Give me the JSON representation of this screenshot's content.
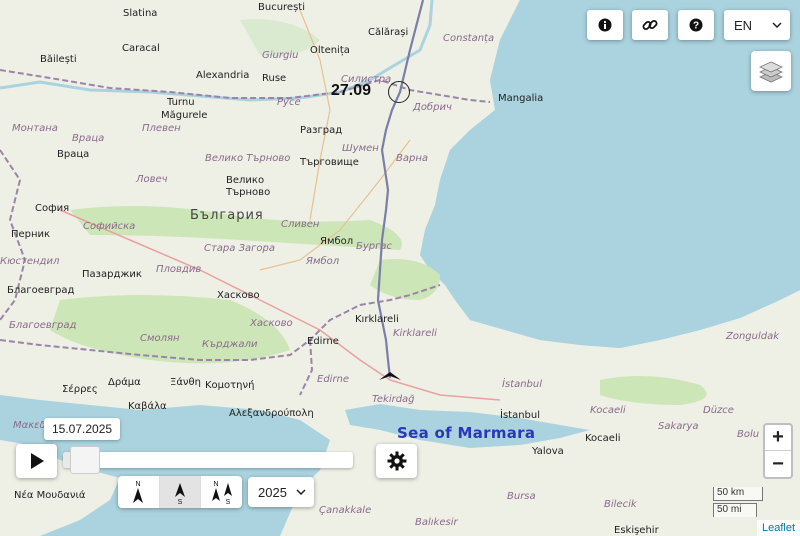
{
  "map": {
    "labels": [
      {
        "name": "place-bucuresti",
        "text": "București",
        "cls": "city"
      },
      {
        "name": "place-slatina",
        "text": "Slatina",
        "cls": "city"
      },
      {
        "name": "place-calarasi",
        "text": "Călărași",
        "cls": "city"
      },
      {
        "name": "place-constanta",
        "text": "Constanța",
        "cls": "region"
      },
      {
        "name": "place-caracal",
        "text": "Caracal",
        "cls": "city"
      },
      {
        "name": "place-giurgiu",
        "text": "Giurgiu",
        "cls": "region"
      },
      {
        "name": "place-oltenita",
        "text": "Oltenița",
        "cls": "city"
      },
      {
        "name": "place-bailesti",
        "text": "Băilești",
        "cls": "city"
      },
      {
        "name": "place-alexandria",
        "text": "Alexandria",
        "cls": "city"
      },
      {
        "name": "place-ruse-ro",
        "text": "Ruse",
        "cls": "city"
      },
      {
        "name": "place-silistra",
        "text": "Силистра",
        "cls": "region"
      },
      {
        "name": "place-mangalia",
        "text": "Mangalia",
        "cls": "city"
      },
      {
        "name": "place-turnu",
        "text": "Turnu",
        "cls": "city"
      },
      {
        "name": "place-magurele",
        "text": "Măgurele",
        "cls": "city"
      },
      {
        "name": "place-ruse",
        "text": "Русе",
        "cls": "region"
      },
      {
        "name": "place-dobrich",
        "text": "Добрич",
        "cls": "region"
      },
      {
        "name": "place-montana",
        "text": "Монтана",
        "cls": "region"
      },
      {
        "name": "place-pleven",
        "text": "Плевен",
        "cls": "region"
      },
      {
        "name": "place-razgrad",
        "text": "Разград",
        "cls": "city"
      },
      {
        "name": "place-vratsa-region",
        "text": "Враца",
        "cls": "region"
      },
      {
        "name": "place-shumen",
        "text": "Шумен",
        "cls": "region"
      },
      {
        "name": "place-vratsa",
        "text": "Враца",
        "cls": "city"
      },
      {
        "name": "place-veliko-tarnovo-region",
        "text": "Велико Търново",
        "cls": "region"
      },
      {
        "name": "place-targovishte",
        "text": "Търговище",
        "cls": "city"
      },
      {
        "name": "place-varna",
        "text": "Варна",
        "cls": "region"
      },
      {
        "name": "place-lovech",
        "text": "Ловеч",
        "cls": "region"
      },
      {
        "name": "place-veliko",
        "text": "Велико",
        "cls": "city"
      },
      {
        "name": "place-tarnovo",
        "text": "Търново",
        "cls": "city"
      },
      {
        "name": "place-sofia",
        "text": "София",
        "cls": "city"
      },
      {
        "name": "place-bulgaria",
        "text": "България",
        "cls": "big"
      },
      {
        "name": "place-pernik",
        "text": "Перник",
        "cls": "city"
      },
      {
        "name": "place-sofiyska",
        "text": "Софийска",
        "cls": "region"
      },
      {
        "name": "place-sliven",
        "text": "Сливен",
        "cls": "region"
      },
      {
        "name": "place-stara-zagora",
        "text": "Стара Загора",
        "cls": "region"
      },
      {
        "name": "place-yambol-city",
        "text": "Ямбол",
        "cls": "city"
      },
      {
        "name": "place-burgas",
        "text": "Бургас",
        "cls": "region"
      },
      {
        "name": "place-kyustendil",
        "text": "Кюстендил",
        "cls": "region"
      },
      {
        "name": "place-yambol",
        "text": "Ямбол",
        "cls": "region"
      },
      {
        "name": "place-pazardzhik",
        "text": "Пазарджик",
        "cls": "city"
      },
      {
        "name": "place-plovdiv",
        "text": "Пловдив",
        "cls": "region"
      },
      {
        "name": "place-blagoevgrad-city",
        "text": "Благоевград",
        "cls": "city"
      },
      {
        "name": "place-haskovo-city",
        "text": "Хасково",
        "cls": "city"
      },
      {
        "name": "place-blagoevgrad",
        "text": "Благоевград",
        "cls": "region"
      },
      {
        "name": "place-haskovo",
        "text": "Хасково",
        "cls": "region"
      },
      {
        "name": "place-kirklareli-city",
        "text": "Kırklareli",
        "cls": "city"
      },
      {
        "name": "place-kirklareli",
        "text": "Kirklareli",
        "cls": "region"
      },
      {
        "name": "place-smolyan",
        "text": "Смолян",
        "cls": "region"
      },
      {
        "name": "place-kardzhali",
        "text": "Кърджали",
        "cls": "region"
      },
      {
        "name": "place-edirne-city",
        "text": "Edirne",
        "cls": "city"
      },
      {
        "name": "place-zonguldak",
        "text": "Zonguldak",
        "cls": "region"
      },
      {
        "name": "place-serres",
        "text": "Σέρρες",
        "cls": "city"
      },
      {
        "name": "place-drama",
        "text": "Δράμα",
        "cls": "city"
      },
      {
        "name": "place-xanthi",
        "text": "Ξάνθη",
        "cls": "city"
      },
      {
        "name": "place-komotini",
        "text": "Κομοτηνή",
        "cls": "city"
      },
      {
        "name": "place-edirne",
        "text": "Edirne",
        "cls": "region"
      },
      {
        "name": "place-istanbul-region",
        "text": "İstanbul",
        "cls": "region"
      },
      {
        "name": "place-kavala",
        "text": "Καβάλα",
        "cls": "city"
      },
      {
        "name": "place-alexandroupoli",
        "text": "Αλεξανδρούπολη",
        "cls": "city"
      },
      {
        "name": "place-tekirdag",
        "text": "Tekirdağ",
        "cls": "region"
      },
      {
        "name": "place-kocaeli-region",
        "text": "Kocaeli",
        "cls": "region"
      },
      {
        "name": "place-duzce",
        "text": "Düzce",
        "cls": "region"
      },
      {
        "name": "place-istanbul",
        "text": "İstanbul",
        "cls": "city"
      },
      {
        "name": "place-makedonia",
        "text": "Μακεδον",
        "cls": "region"
      },
      {
        "name": "place-sakarya",
        "text": "Sakarya",
        "cls": "region"
      },
      {
        "name": "place-sea-of-marmara",
        "text": "Sea of Marmara",
        "cls": "sea"
      },
      {
        "name": "place-kocaeli",
        "text": "Kocaeli",
        "cls": "city"
      },
      {
        "name": "place-yalova",
        "text": "Yalova",
        "cls": "city"
      },
      {
        "name": "place-bolu",
        "text": "Bolu",
        "cls": "region"
      },
      {
        "name": "place-nea-moudania",
        "text": "Νέα Μουδανιά",
        "cls": "city"
      },
      {
        "name": "place-canakkale",
        "text": "Çanakkale",
        "cls": "region"
      },
      {
        "name": "place-bursa",
        "text": "Bursa",
        "cls": "region"
      },
      {
        "name": "place-bilecik",
        "text": "Bilecik",
        "cls": "region"
      },
      {
        "name": "place-balikesir",
        "text": "Balıkesir",
        "cls": "region"
      },
      {
        "name": "place-eskisehir",
        "text": "Eskişehir",
        "cls": "city"
      }
    ],
    "track_date_label": "27.09",
    "track_color": "#7b7fa8"
  },
  "toolbar": {
    "info_icon": "info-icon",
    "link_icon": "link-icon",
    "help_icon": "help-icon",
    "language": "EN",
    "layers_icon": "layers-icon"
  },
  "timeline": {
    "current_date": "15.07.2025",
    "progress": 0.04,
    "year": "2025"
  },
  "orientation": {
    "options": [
      "north-up",
      "track-up",
      "north-south"
    ],
    "active": 1,
    "label_n": "N",
    "label_s": "S"
  },
  "zoom": {
    "in": "+",
    "out": "−"
  },
  "scale": {
    "km": "50 km",
    "mi": "50 mi"
  },
  "attribution": "Leaflet",
  "colors": {
    "water": "#aad3df",
    "land": "#eef0e6",
    "forest": "#cde6b8",
    "border": "#9c84a8"
  }
}
